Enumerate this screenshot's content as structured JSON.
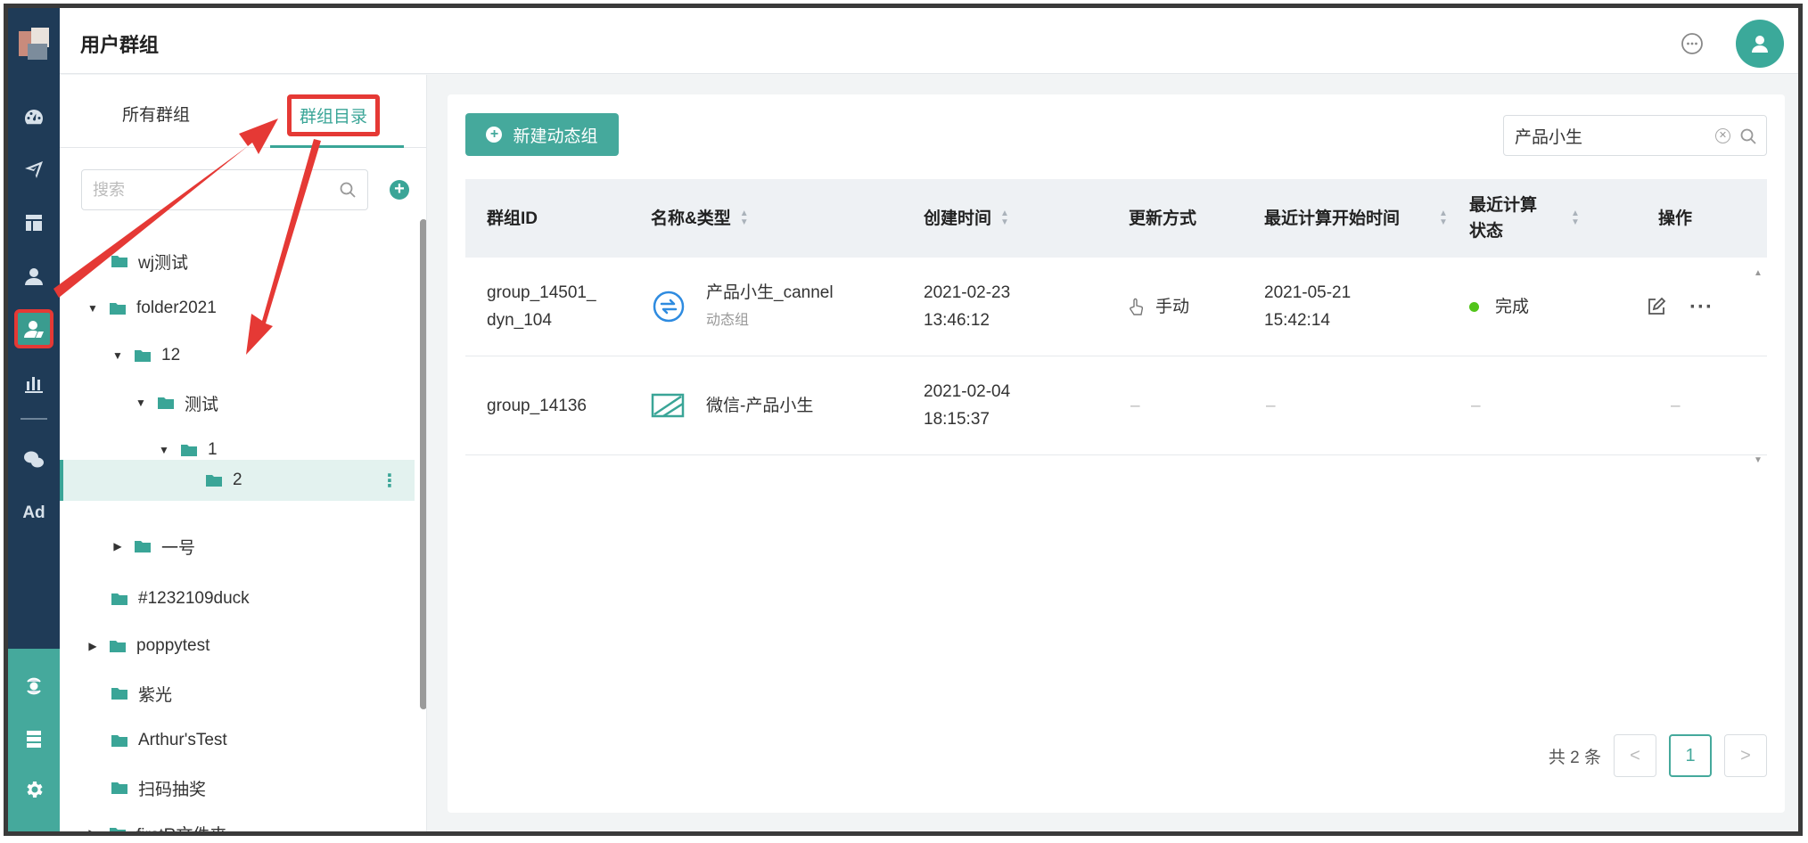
{
  "header": {
    "title": "用户群组",
    "chat_icon": "chat-bubble-icon",
    "avatar_icon": "user-icon"
  },
  "nav": {
    "icons": [
      "dashboard-icon",
      "send-icon",
      "layout-icon",
      "user-icon",
      "user-group-icon",
      "bar-chart-icon",
      "wechat-icon"
    ],
    "ad_label": "Ad",
    "bottom_icons": [
      "hub-icon",
      "server-icon",
      "gear-icon"
    ],
    "active": "user-group-icon"
  },
  "tree": {
    "tab_all": "所有群组",
    "tab_dir": "群组目录",
    "search_placeholder": "搜索",
    "nodes": [
      {
        "label": "wj测试"
      },
      {
        "label": "folder2021"
      },
      {
        "label": "12"
      },
      {
        "label": "测试"
      },
      {
        "label": "1"
      },
      {
        "label": "2"
      },
      {
        "label": "一号"
      },
      {
        "label": "#1232109duck"
      },
      {
        "label": "poppytest"
      },
      {
        "label": "紫光"
      },
      {
        "label": "Arthur'sTest"
      },
      {
        "label": "扫码抽奖"
      },
      {
        "label": "firstR文件夹"
      }
    ]
  },
  "main": {
    "new_button": "新建动态组",
    "search_value": "产品小生",
    "columns": [
      "群组ID",
      "名称&类型",
      "创建时间",
      "更新方式",
      "最近计算开始时间",
      "最近计算状态",
      "操作"
    ],
    "rows": [
      {
        "id": "group_14501_dyn_104",
        "id_line1": "group_14501_",
        "id_line2": "dyn_104",
        "name": "产品小生_cannel",
        "type": "动态组",
        "created_date": "2021-02-23",
        "created_time": "13:46:12",
        "update": "手动",
        "calc_date": "2021-05-21",
        "calc_time": "15:42:14",
        "status": "完成"
      },
      {
        "id": "group_14136",
        "name": "微信-产品小生",
        "created_date": "2021-02-04",
        "created_time": "18:15:37",
        "update": "–",
        "calc": "–",
        "status": "–",
        "ops": "–"
      }
    ],
    "total": "共 2 条",
    "page": "1",
    "prev": "<",
    "next": ">"
  },
  "colors": {
    "accent": "#45a99c",
    "annotation": "#e53935",
    "nav": "#1f3b57",
    "status_ok": "#52c41a"
  }
}
